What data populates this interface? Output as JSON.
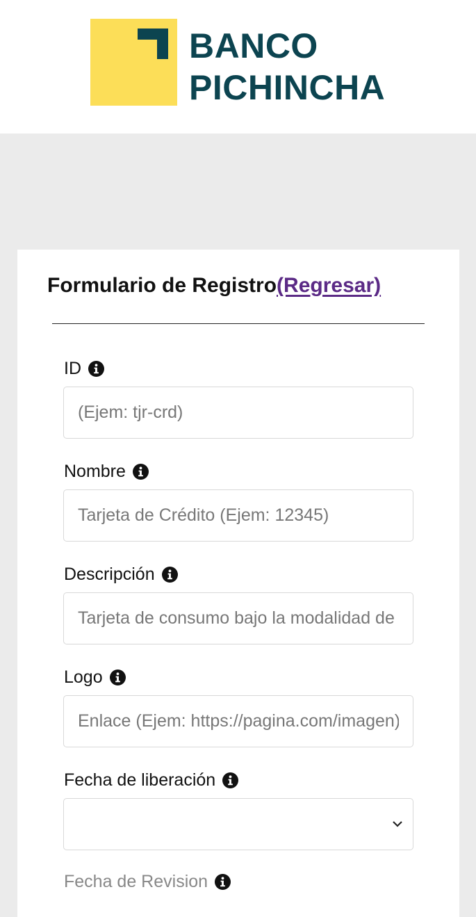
{
  "header": {
    "brand_line1": "BANCO",
    "brand_line2": "PICHINCHA",
    "colors": {
      "logo_yellow": "#fcde58",
      "brand_teal": "#0c4450"
    }
  },
  "form": {
    "title": "Formulario de Registro",
    "back_link": "(Regresar)",
    "fields": [
      {
        "label": "ID",
        "placeholder": "(Ejem: tjr-crd)",
        "value": ""
      },
      {
        "label": "Nombre",
        "placeholder": "Tarjeta de Crédito (Ejem: 12345)",
        "value": ""
      },
      {
        "label": "Descripción",
        "placeholder": "Tarjeta de consumo bajo la modalidad de",
        "value": ""
      },
      {
        "label": "Logo",
        "placeholder": "Enlace (Ejem: https://pagina.com/imagen)",
        "value": ""
      },
      {
        "label": "Fecha de liberación",
        "value": ""
      },
      {
        "label": "Fecha de Revision"
      }
    ],
    "icons": {
      "info": "info-circle-icon",
      "dropdown": "chevron-down-icon"
    }
  }
}
